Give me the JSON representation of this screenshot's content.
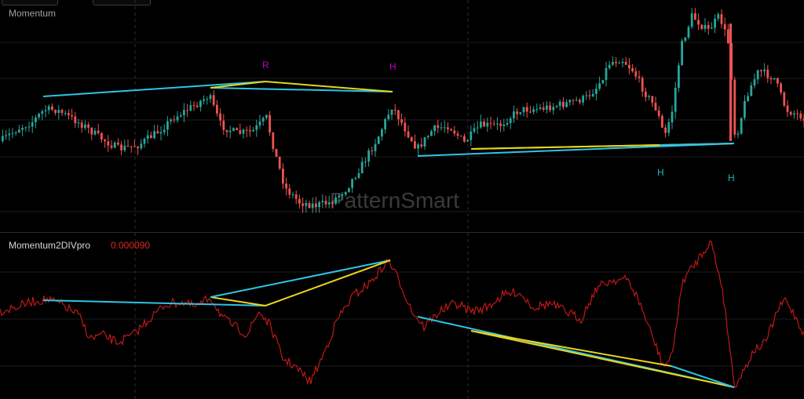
{
  "price_pane": {
    "title": "Momentum",
    "watermark": "PatternSmart",
    "labels": [
      {
        "text": "R",
        "color": "#c000c0",
        "key": "r"
      },
      {
        "text": "H",
        "color": "#c000c0",
        "key": "h-top"
      },
      {
        "text": "H",
        "color": "#1fb5b0",
        "key": "h-low-1"
      },
      {
        "text": "H",
        "color": "#1fb5b0",
        "key": "h-low-2"
      }
    ]
  },
  "osc_pane": {
    "title": "Momentum2DIVpro",
    "value": "0.000090"
  },
  "colors": {
    "background": "#000000",
    "bull_candle": "#26a69a",
    "bear_candle": "#ef5350",
    "trendline_cyan": "#2ec4e6",
    "trendline_yellow": "#e6d41e",
    "oscillator": "#c01818",
    "grid": "#1c1c1c"
  }
}
